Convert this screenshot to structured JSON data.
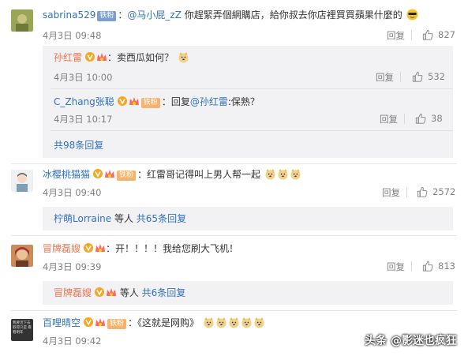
{
  "comments": [
    {
      "user": "sabrina529",
      "badge": "铁粉",
      "mention": "@马小屁_zZ",
      "text": "你趕緊弄個網購店，給你叔去你店裡買買蘋果什麼的",
      "time": "4月3日 09:48",
      "reply_label": "回复",
      "likes": "827",
      "subs": [
        {
          "user": "孙红雷",
          "text": "：卖西瓜如何？",
          "time": "4月3日 10:00",
          "reply_label": "回复",
          "likes": "532"
        },
        {
          "user": "C_Zhang张聪",
          "badge": "铁粉",
          "text_prefix": "：回复",
          "mention": "@孙红雷",
          "text": ":保熟？",
          "time": "4月3日 10:17",
          "reply_label": "回复",
          "likes": "38"
        }
      ],
      "more_count": "共98条回复"
    },
    {
      "user": "冰樱桃猫猫",
      "badge": "铁粉",
      "text": "：红雷哥记得叫上男人帮一起",
      "time": "4月3日 09:40",
      "reply_label": "回复",
      "likes": "2572",
      "more_user": "柠萌Lorraine",
      "more_mid": " 等人 ",
      "more_count": "共65条回复"
    },
    {
      "user": "冒牌磊嫂",
      "text": "：开！！！！我给您刷大飞机！",
      "time": "4月3日 09:39",
      "reply_label": "回复",
      "likes": "813",
      "more_user": "冒牌磊嫂",
      "more_mid": " 等人 ",
      "more_count": "共6条回复"
    },
    {
      "user": "百哩晴空",
      "badge": "铁粉",
      "text": "：《这就是网购》",
      "time": "4月3日 09:42",
      "avatar_text": "我要活下去 取得只是 看看明年"
    }
  ],
  "watermark": "头条 @影迷也疯狂",
  "colors": {
    "username": "#eb7350",
    "link": "#3072c0",
    "meta": "#808080",
    "subbox": "#f2f2f5"
  }
}
